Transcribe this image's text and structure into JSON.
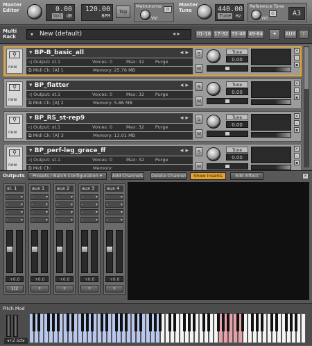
{
  "header": {
    "master_editor": "Master\nEditor",
    "vol_value": "0.00",
    "vol_unit": "dB",
    "vol_badge": "Vol",
    "bpm_value": "120.00",
    "bpm_unit": "BPM",
    "tap_label": "Tap",
    "metronome_label": "Metronome",
    "metronome_vol": "Vol",
    "master_tune": "Master\nTune",
    "tune_value": "440.00",
    "tune_badge": "Tune",
    "tune_unit": "Hz",
    "ref_tone_label": "Reference Tone",
    "ref_vol": "Vol",
    "ref_note": "A3"
  },
  "rack": {
    "label": "Multi\nRack",
    "preset_name": "New (default)",
    "page_tabs": [
      "01-16",
      "17-32",
      "33-48",
      "49-64"
    ],
    "aux_label": "AUX"
  },
  "instruments": [
    {
      "name": "BP-B_basic_all",
      "output": "st.1",
      "voices": "0",
      "max": "32",
      "purge": "Purge",
      "midi": "[A] 1",
      "memory": "25.76 MB",
      "tune": "0.00",
      "selected": true
    },
    {
      "name": "BP_flatter",
      "output": "st.1",
      "voices": "0",
      "max": "32",
      "purge": "Purge",
      "midi": "[A] 2",
      "memory": "5.86 MB",
      "tune": "0.00",
      "selected": false
    },
    {
      "name": "BP_RS_st-rep9",
      "output": "st.1",
      "voices": "0",
      "max": "32",
      "purge": "Purge",
      "midi": "[A] 3",
      "memory": "13.01 MB",
      "tune": "0.00",
      "selected": false
    },
    {
      "name": "BP_perf-leg_grace_ff",
      "output": "st.1",
      "voices": "0",
      "max": "32",
      "purge": "Purge",
      "midi": "",
      "memory": "",
      "tune": "0.00",
      "selected": false
    }
  ],
  "inst_labels": {
    "output": "Output:",
    "voices": "Voices:",
    "max": "Max:",
    "midi": "Midi Ch:",
    "memory": "Memory:",
    "tune": "Tune",
    "s": "S",
    "m": "M",
    "new": "new"
  },
  "outputs": {
    "title": "Outputs",
    "presets_button": "Presets / Batch Configuration",
    "add_channels": "Add Channels",
    "delete_channel": "Delete Channel",
    "show_inserts": "Show Inserts",
    "edit_effect": "Edit Effect",
    "channels": [
      {
        "name": "st. 1",
        "vol": "+0.0",
        "footer": "1|2"
      },
      {
        "name": "aux 1",
        "vol": "+0.0",
        "footer": "+"
      },
      {
        "name": "aux 2",
        "vol": "+0.0",
        "footer": "+"
      },
      {
        "name": "aux 3",
        "vol": "+0.0",
        "footer": "+"
      },
      {
        "name": "aux 4",
        "vol": "+0.0",
        "footer": "+"
      }
    ]
  },
  "keyboard": {
    "pitch_mod": "Pitch Mod",
    "octave": "+2 oct"
  },
  "colors": {
    "accent_orange": "#e7a02a",
    "key_blue": "#b9c8ef",
    "key_red": "#e8a0a8"
  }
}
